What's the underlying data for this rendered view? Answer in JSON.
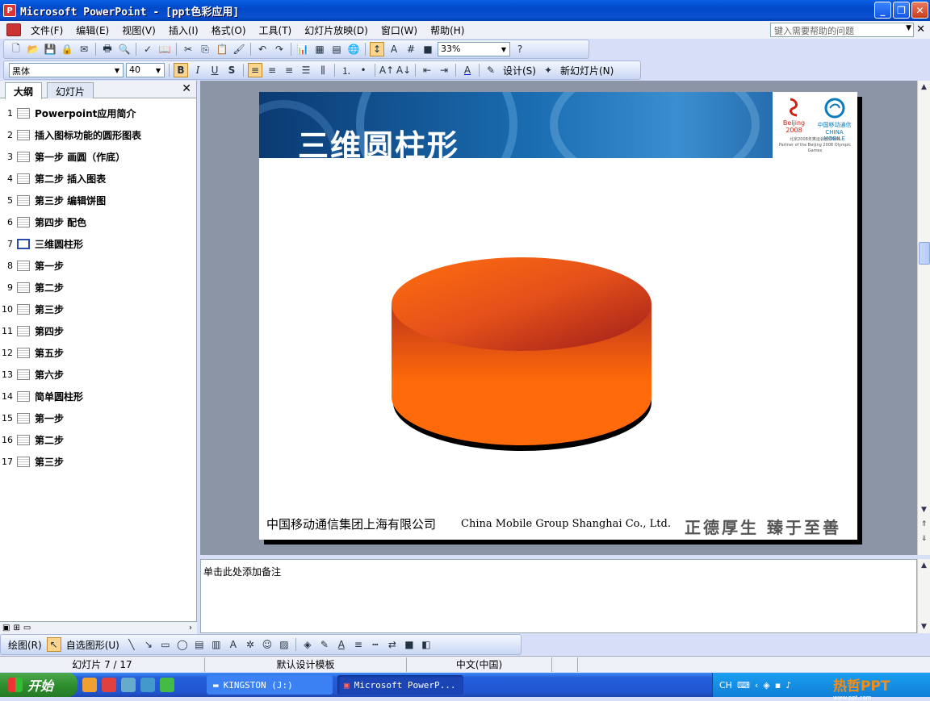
{
  "window": {
    "title": "Microsoft PowerPoint - [ppt色彩应用]"
  },
  "menu": {
    "items": [
      "文件(F)",
      "编辑(E)",
      "视图(V)",
      "插入(I)",
      "格式(O)",
      "工具(T)",
      "幻灯片放映(D)",
      "窗口(W)",
      "帮助(H)"
    ],
    "help_placeholder": "键入需要帮助的问题"
  },
  "standard_toolbar": {
    "zoom": "33%"
  },
  "format_toolbar": {
    "font": "黑体",
    "size": "40",
    "bold": "B",
    "italic": "I",
    "underline": "U",
    "shadow": "S",
    "design_label": "设计(S)",
    "new_slide_label": "新幻灯片(N)"
  },
  "outline": {
    "tabs": [
      "大纲",
      "幻灯片"
    ],
    "selected_index": 7,
    "slides": [
      {
        "num": "1",
        "title": "Powerpoint应用简介"
      },
      {
        "num": "2",
        "title": "插入图标功能的圆形图表"
      },
      {
        "num": "3",
        "title": "第一步  画圆（作底）"
      },
      {
        "num": "4",
        "title": "第二步  插入图表"
      },
      {
        "num": "5",
        "title": "第三步  编辑饼图"
      },
      {
        "num": "6",
        "title": "第四步  配色"
      },
      {
        "num": "7",
        "title": "三维圆柱形"
      },
      {
        "num": "8",
        "title": "第一步"
      },
      {
        "num": "9",
        "title": "第二步"
      },
      {
        "num": "10",
        "title": "第三步"
      },
      {
        "num": "11",
        "title": "第四步"
      },
      {
        "num": "12",
        "title": "第五步"
      },
      {
        "num": "13",
        "title": "第六步"
      },
      {
        "num": "14",
        "title": "简单圆柱形"
      },
      {
        "num": "15",
        "title": "第一步"
      },
      {
        "num": "16",
        "title": "第二步"
      },
      {
        "num": "17",
        "title": "第三步"
      }
    ]
  },
  "slide": {
    "title": "三维圆柱形",
    "footer_cn": "中国移动通信集团上海有限公司",
    "footer_en": "China Mobile Group Shanghai Co., Ltd.",
    "motto": "正德厚生 臻于至善",
    "logo_beijing": "Beijing 2008",
    "logo_cm_cn": "中国移动通信",
    "logo_cm_en": "CHINA MOBILE",
    "partner_cn": "北京2008年奥运会合作伙伴",
    "partner_en": "Partner of the Beijing 2008 Olympic Games",
    "colors": {
      "cylinder_body": "#ff6a0a",
      "cylinder_top_dark": "#a8201a",
      "banner": "#0b3a72"
    }
  },
  "notes": {
    "placeholder": "单击此处添加备注"
  },
  "drawing_toolbar": {
    "draw_label": "绘图(R)",
    "autoshapes_label": "自选图形(U)"
  },
  "status": {
    "slide": "幻灯片 7 / 17",
    "template": "默认设计模板",
    "language": "中文(中国)"
  },
  "taskbar": {
    "start": "开始",
    "tasks": [
      "KINGSTON (J:)",
      "Microsoft PowerP..."
    ],
    "lang": "CH",
    "watermark": "热哲PPT",
    "watermark_url": "www.ppt.com"
  }
}
